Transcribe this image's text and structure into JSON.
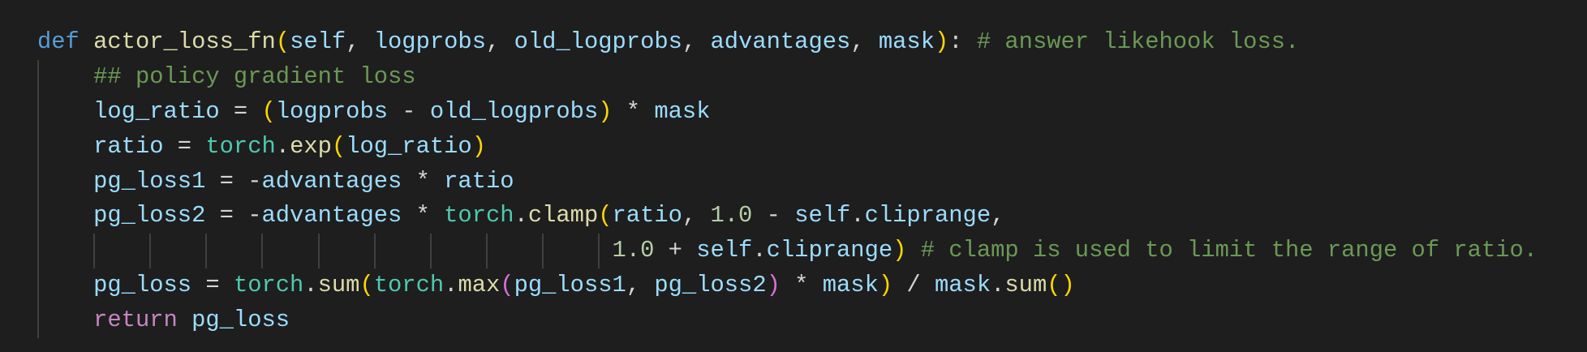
{
  "colors": {
    "background": "#1e1e1e",
    "keyword": "#569cd6",
    "function": "#dcdcaa",
    "variable": "#9cdcfe",
    "comment": "#6a9955",
    "class": "#4ec9b0",
    "number": "#b5cea8"
  },
  "lines": [
    {
      "indent": 0,
      "tokens": [
        [
          "def",
          "kw"
        ],
        [
          " ",
          "op"
        ],
        [
          "actor_loss_fn",
          "fn"
        ],
        [
          "(",
          "b1"
        ],
        [
          "self",
          "var"
        ],
        [
          ", ",
          "op"
        ],
        [
          "logprobs",
          "var"
        ],
        [
          ", ",
          "op"
        ],
        [
          "old_logprobs",
          "var"
        ],
        [
          ", ",
          "op"
        ],
        [
          "advantages",
          "var"
        ],
        [
          ", ",
          "op"
        ],
        [
          "mask",
          "var"
        ],
        [
          ")",
          "b1"
        ],
        [
          ": ",
          "op"
        ],
        [
          "# answer likehook loss.",
          "cm"
        ]
      ]
    },
    {
      "indent": 4,
      "tokens": [
        [
          "## policy gradient loss",
          "cm"
        ]
      ]
    },
    {
      "indent": 4,
      "tokens": [
        [
          "log_ratio",
          "var"
        ],
        [
          " = ",
          "op"
        ],
        [
          "(",
          "b1"
        ],
        [
          "logprobs",
          "var"
        ],
        [
          " - ",
          "op"
        ],
        [
          "old_logprobs",
          "var"
        ],
        [
          ")",
          "b1"
        ],
        [
          " * ",
          "op"
        ],
        [
          "mask",
          "var"
        ]
      ]
    },
    {
      "indent": 4,
      "tokens": [
        [
          "ratio",
          "var"
        ],
        [
          " = ",
          "op"
        ],
        [
          "torch",
          "cls"
        ],
        [
          ".",
          "op"
        ],
        [
          "exp",
          "fn"
        ],
        [
          "(",
          "b1"
        ],
        [
          "log_ratio",
          "var"
        ],
        [
          ")",
          "b1"
        ]
      ]
    },
    {
      "indent": 4,
      "tokens": [
        [
          "pg_loss1",
          "var"
        ],
        [
          " = -",
          "op"
        ],
        [
          "advantages",
          "var"
        ],
        [
          " * ",
          "op"
        ],
        [
          "ratio",
          "var"
        ]
      ]
    },
    {
      "indent": 4,
      "tokens": [
        [
          "pg_loss2",
          "var"
        ],
        [
          " = -",
          "op"
        ],
        [
          "advantages",
          "var"
        ],
        [
          " * ",
          "op"
        ],
        [
          "torch",
          "cls"
        ],
        [
          ".",
          "op"
        ],
        [
          "clamp",
          "fn"
        ],
        [
          "(",
          "b1"
        ],
        [
          "ratio",
          "var"
        ],
        [
          ", ",
          "op"
        ],
        [
          "1.0",
          "num"
        ],
        [
          " - ",
          "op"
        ],
        [
          "self",
          "var"
        ],
        [
          ".",
          "op"
        ],
        [
          "cliprange",
          "var"
        ],
        [
          ",",
          "op"
        ]
      ]
    },
    {
      "indent": 41,
      "tokens": [
        [
          "1.0",
          "num"
        ],
        [
          " + ",
          "op"
        ],
        [
          "self",
          "var"
        ],
        [
          ".",
          "op"
        ],
        [
          "cliprange",
          "var"
        ],
        [
          ")",
          "b1"
        ],
        [
          " ",
          "op"
        ],
        [
          "# clamp is used to limit the range of ratio.",
          "cm"
        ]
      ]
    },
    {
      "indent": 4,
      "tokens": [
        [
          "pg_loss",
          "var"
        ],
        [
          " = ",
          "op"
        ],
        [
          "torch",
          "cls"
        ],
        [
          ".",
          "op"
        ],
        [
          "sum",
          "fn"
        ],
        [
          "(",
          "b1"
        ],
        [
          "torch",
          "cls"
        ],
        [
          ".",
          "op"
        ],
        [
          "max",
          "fn"
        ],
        [
          "(",
          "b2"
        ],
        [
          "pg_loss1",
          "var"
        ],
        [
          ", ",
          "op"
        ],
        [
          "pg_loss2",
          "var"
        ],
        [
          ")",
          "b2"
        ],
        [
          " * ",
          "op"
        ],
        [
          "mask",
          "var"
        ],
        [
          ")",
          "b1"
        ],
        [
          " / ",
          "op"
        ],
        [
          "mask",
          "var"
        ],
        [
          ".",
          "op"
        ],
        [
          "sum",
          "fn"
        ],
        [
          "()",
          "b1"
        ]
      ]
    },
    {
      "indent": 4,
      "tokens": [
        [
          "return",
          "ctl"
        ],
        [
          " ",
          "op"
        ],
        [
          "pg_loss",
          "var"
        ]
      ]
    }
  ]
}
